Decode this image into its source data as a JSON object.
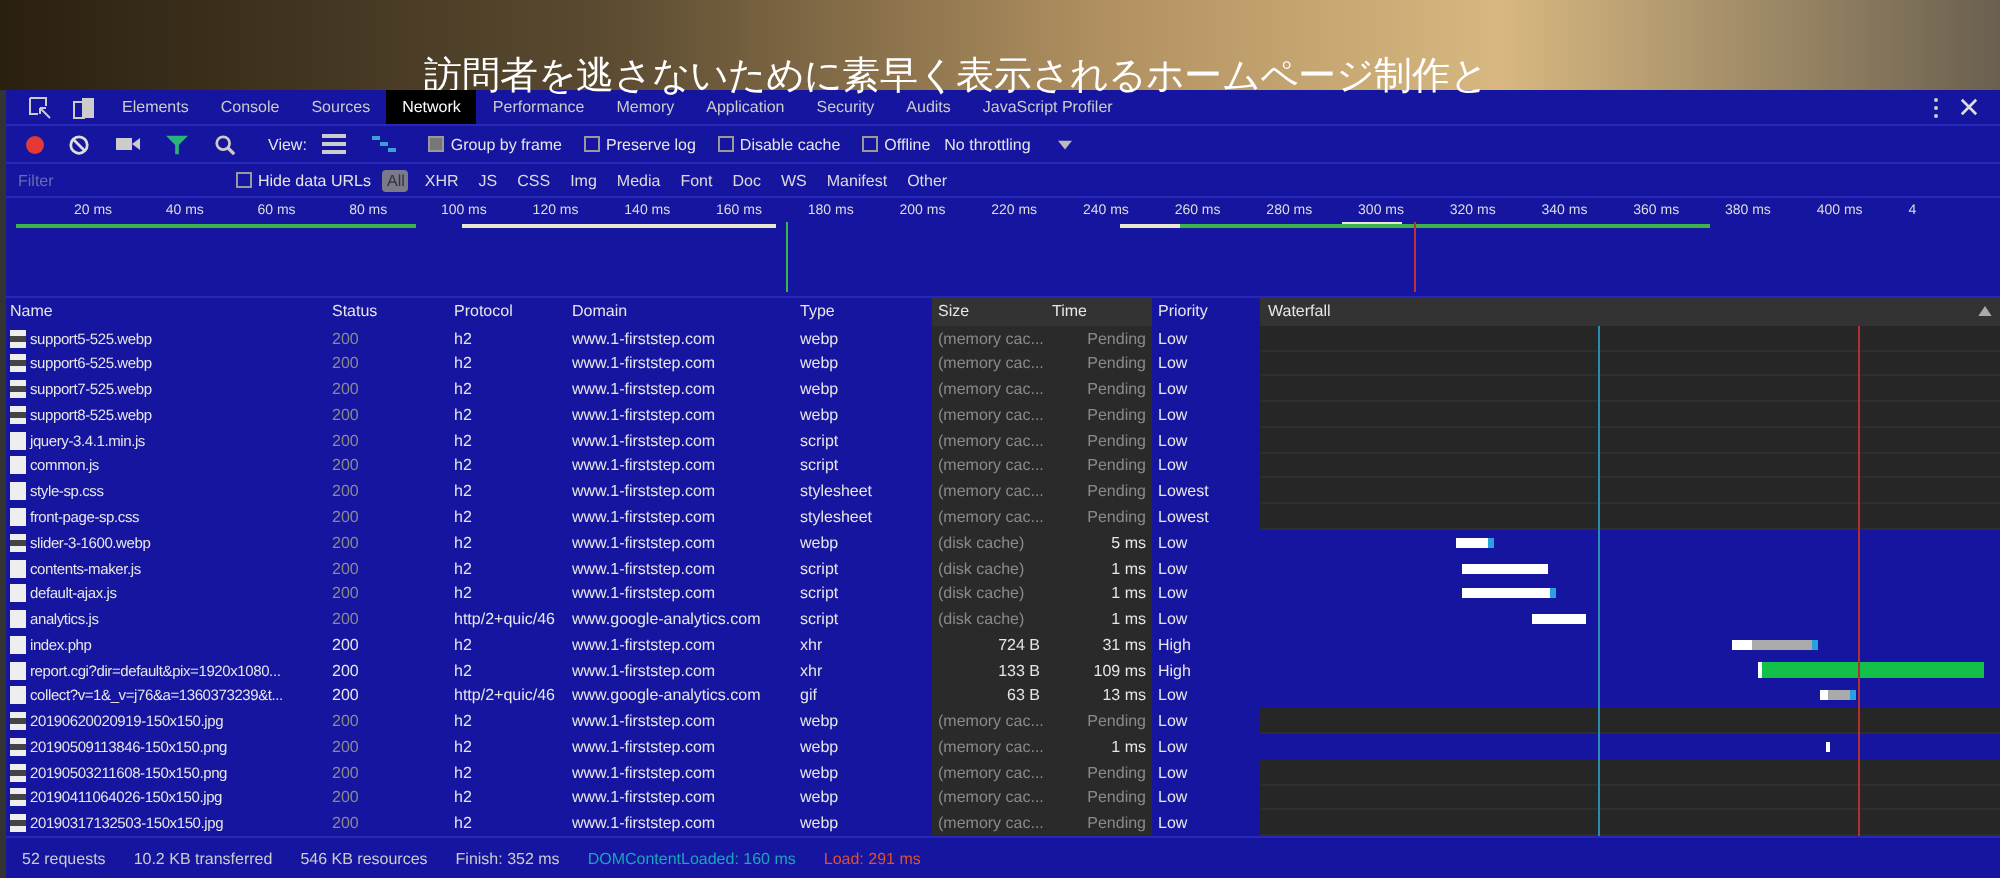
{
  "page_heading": "訪問者を逃さないために素早く表示されるホームページ制作と",
  "tabs": [
    {
      "label": "Elements",
      "selected": false
    },
    {
      "label": "Console",
      "selected": false
    },
    {
      "label": "Sources",
      "selected": false
    },
    {
      "label": "Network",
      "selected": true
    },
    {
      "label": "Performance",
      "selected": false
    },
    {
      "label": "Memory",
      "selected": false
    },
    {
      "label": "Application",
      "selected": false
    },
    {
      "label": "Security",
      "selected": false
    },
    {
      "label": "Audits",
      "selected": false
    },
    {
      "label": "JavaScript Profiler",
      "selected": false
    }
  ],
  "toolbar": {
    "recording": true,
    "view_label": "View:",
    "options": [
      {
        "label": "Group by frame",
        "checked": true
      },
      {
        "label": "Preserve log",
        "checked": false
      },
      {
        "label": "Disable cache",
        "checked": false
      },
      {
        "label": "Offline",
        "checked": false
      }
    ],
    "throttling": "No throttling"
  },
  "filter": {
    "placeholder": "Filter",
    "hide_data_urls": {
      "label": "Hide data URLs",
      "checked": false
    },
    "types": [
      {
        "label": "All",
        "selected": true
      },
      {
        "label": "XHR",
        "selected": false
      },
      {
        "label": "JS",
        "selected": false
      },
      {
        "label": "CSS",
        "selected": false
      },
      {
        "label": "Img",
        "selected": false
      },
      {
        "label": "Media",
        "selected": false
      },
      {
        "label": "Font",
        "selected": false
      },
      {
        "label": "Doc",
        "selected": false
      },
      {
        "label": "WS",
        "selected": false
      },
      {
        "label": "Manifest",
        "selected": false
      },
      {
        "label": "Other",
        "selected": false
      }
    ]
  },
  "timeline_ticks": [
    "20 ms",
    "40 ms",
    "60 ms",
    "80 ms",
    "100 ms",
    "120 ms",
    "140 ms",
    "160 ms",
    "180 ms",
    "200 ms",
    "220 ms",
    "240 ms",
    "260 ms",
    "280 ms",
    "300 ms",
    "320 ms",
    "340 ms",
    "360 ms",
    "380 ms",
    "400 ms",
    "4"
  ],
  "table": {
    "columns": [
      "Name",
      "Status",
      "Protocol",
      "Domain",
      "Type",
      "Size",
      "Time",
      "Priority",
      "Waterfall"
    ],
    "rows": [
      {
        "kind": "image",
        "name": "support5-525.webp",
        "status": "200",
        "protocol": "h2",
        "domain": "www.1-firststep.com",
        "type": "webp",
        "size": "(memory cac...",
        "time": "Pending",
        "priority": "Low",
        "network": false,
        "pending": true
      },
      {
        "kind": "image",
        "name": "support6-525.webp",
        "status": "200",
        "protocol": "h2",
        "domain": "www.1-firststep.com",
        "type": "webp",
        "size": "(memory cac...",
        "time": "Pending",
        "priority": "Low",
        "network": false,
        "pending": true
      },
      {
        "kind": "image",
        "name": "support7-525.webp",
        "status": "200",
        "protocol": "h2",
        "domain": "www.1-firststep.com",
        "type": "webp",
        "size": "(memory cac...",
        "time": "Pending",
        "priority": "Low",
        "network": false,
        "pending": true
      },
      {
        "kind": "image",
        "name": "support8-525.webp",
        "status": "200",
        "protocol": "h2",
        "domain": "www.1-firststep.com",
        "type": "webp",
        "size": "(memory cac...",
        "time": "Pending",
        "priority": "Low",
        "network": false,
        "pending": true
      },
      {
        "kind": "file",
        "name": "jquery-3.4.1.min.js",
        "status": "200",
        "protocol": "h2",
        "domain": "www.1-firststep.com",
        "type": "script",
        "size": "(memory cac...",
        "time": "Pending",
        "priority": "Low",
        "network": false,
        "pending": true
      },
      {
        "kind": "file",
        "name": "common.js",
        "status": "200",
        "protocol": "h2",
        "domain": "www.1-firststep.com",
        "type": "script",
        "size": "(memory cac...",
        "time": "Pending",
        "priority": "Low",
        "network": false,
        "pending": true
      },
      {
        "kind": "file",
        "name": "style-sp.css",
        "status": "200",
        "protocol": "h2",
        "domain": "www.1-firststep.com",
        "type": "stylesheet",
        "size": "(memory cac...",
        "time": "Pending",
        "priority": "Lowest",
        "network": false,
        "pending": true
      },
      {
        "kind": "file",
        "name": "front-page-sp.css",
        "status": "200",
        "protocol": "h2",
        "domain": "www.1-firststep.com",
        "type": "stylesheet",
        "size": "(memory cac...",
        "time": "Pending",
        "priority": "Lowest",
        "network": false,
        "pending": true
      },
      {
        "kind": "image",
        "name": "slider-3-1600.webp",
        "status": "200",
        "protocol": "h2",
        "domain": "www.1-firststep.com",
        "type": "webp",
        "size": "(disk cache)",
        "time": "5 ms",
        "priority": "Low",
        "network": false,
        "pending": false
      },
      {
        "kind": "file",
        "name": "contents-maker.js",
        "status": "200",
        "protocol": "h2",
        "domain": "www.1-firststep.com",
        "type": "script",
        "size": "(disk cache)",
        "time": "1 ms",
        "priority": "Low",
        "network": false,
        "pending": false
      },
      {
        "kind": "file",
        "name": "default-ajax.js",
        "status": "200",
        "protocol": "h2",
        "domain": "www.1-firststep.com",
        "type": "script",
        "size": "(disk cache)",
        "time": "1 ms",
        "priority": "Low",
        "network": false,
        "pending": false
      },
      {
        "kind": "file",
        "name": "analytics.js",
        "status": "200",
        "protocol": "http/2+quic/46",
        "domain": "www.google-analytics.com",
        "type": "script",
        "size": "(disk cache)",
        "time": "1 ms",
        "priority": "Low",
        "network": false,
        "pending": false
      },
      {
        "kind": "file",
        "name": "index.php",
        "status": "200",
        "protocol": "h2",
        "domain": "www.1-firststep.com",
        "type": "xhr",
        "size": "724 B",
        "time": "31 ms",
        "priority": "High",
        "network": true,
        "pending": false
      },
      {
        "kind": "file",
        "name": "report.cgi?dir=default&pix=1920x1080...",
        "status": "200",
        "protocol": "h2",
        "domain": "www.1-firststep.com",
        "type": "xhr",
        "size": "133 B",
        "time": "109 ms",
        "priority": "High",
        "network": true,
        "pending": false
      },
      {
        "kind": "file",
        "name": "collect?v=1&_v=j76&a=1360373239&t...",
        "status": "200",
        "protocol": "http/2+quic/46",
        "domain": "www.google-analytics.com",
        "type": "gif",
        "size": "63 B",
        "time": "13 ms",
        "priority": "Low",
        "network": true,
        "pending": false
      },
      {
        "kind": "image",
        "name": "20190620020919-150x150.jpg",
        "status": "200",
        "protocol": "h2",
        "domain": "www.1-firststep.com",
        "type": "webp",
        "size": "(memory cac...",
        "time": "Pending",
        "priority": "Low",
        "network": false,
        "pending": true
      },
      {
        "kind": "image",
        "name": "20190509113846-150x150.png",
        "status": "200",
        "protocol": "h2",
        "domain": "www.1-firststep.com",
        "type": "webp",
        "size": "(memory cac...",
        "time": "1 ms",
        "priority": "Low",
        "network": false,
        "pending": false
      },
      {
        "kind": "image",
        "name": "20190503211608-150x150.png",
        "status": "200",
        "protocol": "h2",
        "domain": "www.1-firststep.com",
        "type": "webp",
        "size": "(memory cac...",
        "time": "Pending",
        "priority": "Low",
        "network": false,
        "pending": true
      },
      {
        "kind": "image",
        "name": "20190411064026-150x150.jpg",
        "status": "200",
        "protocol": "h2",
        "domain": "www.1-firststep.com",
        "type": "webp",
        "size": "(memory cac...",
        "time": "Pending",
        "priority": "Low",
        "network": false,
        "pending": true
      },
      {
        "kind": "image",
        "name": "20190317132503-150x150.jpg",
        "status": "200",
        "protocol": "h2",
        "domain": "www.1-firststep.com",
        "type": "webp",
        "size": "(memory cac...",
        "time": "Pending",
        "priority": "Low",
        "network": false,
        "pending": true
      }
    ]
  },
  "status_bar": [
    {
      "kind": "plain",
      "text": "52 requests"
    },
    {
      "kind": "plain",
      "text": "10.2 KB transferred"
    },
    {
      "kind": "plain",
      "text": "546 KB resources"
    },
    {
      "kind": "plain",
      "text": "Finish: 352 ms"
    },
    {
      "kind": "dom",
      "text": "DOMContentLoaded: 160 ms"
    },
    {
      "kind": "load",
      "text": "Load: 291 ms"
    }
  ]
}
